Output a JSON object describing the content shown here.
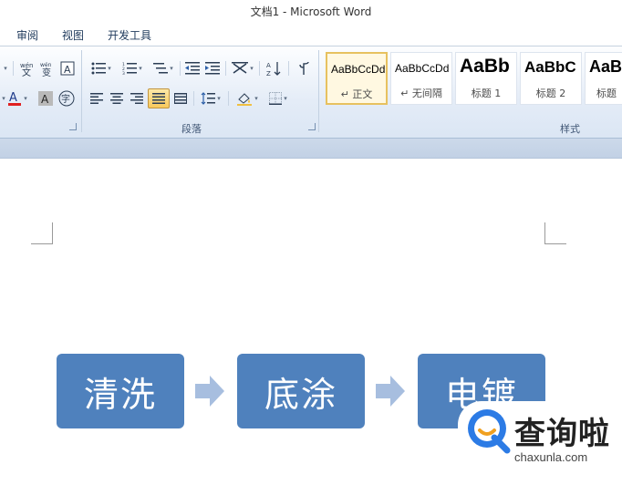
{
  "window": {
    "title": "文档1 - Microsoft Word"
  },
  "tabs": [
    {
      "label": "审阅"
    },
    {
      "label": "视图"
    },
    {
      "label": "开发工具"
    }
  ],
  "ribbon": {
    "paragraph_group_label": "段落",
    "styles_group_label": "样式",
    "active_button": "justify",
    "styles": [
      {
        "sample": "AaBbCcDd",
        "name": "↵ 正文",
        "selected": true
      },
      {
        "sample": "AaBbCcDd",
        "name": "↵ 无间隔",
        "selected": false
      },
      {
        "sample": "AaBb",
        "name": "标题 1",
        "selected": false
      },
      {
        "sample": "AaBbC",
        "name": "标题 2",
        "selected": false
      },
      {
        "sample": "AaB",
        "name": "标题",
        "selected": false
      }
    ]
  },
  "document": {
    "process_steps": [
      "清洗",
      "底涂",
      "电镀"
    ],
    "box_color": "#4f81bd",
    "arrow_color": "#a7bedf"
  },
  "watermark": {
    "brand": "查询啦",
    "url": "chaxunla.com",
    "accent": "#2c7be5"
  },
  "icons": {
    "font_color_letter": "A",
    "shading_letter": "A",
    "phonetic_char": "wén",
    "char_border_letter": "A",
    "enclose_char": "字"
  }
}
